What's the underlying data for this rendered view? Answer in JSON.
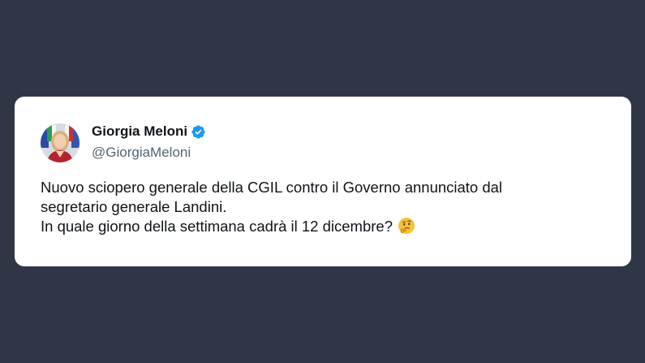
{
  "tweet": {
    "author": {
      "display_name": "Giorgia Meloni",
      "handle": "@GiorgiaMeloni",
      "verified": true
    },
    "text_lines": [
      "Nuovo sciopero generale della CGIL contro il Governo annunciato dal",
      "segretario generale Landini.",
      "In quale giorno della settimana cadrà il 12 dicembre?"
    ],
    "emoji": "thinking-face-icon"
  },
  "colors": {
    "background": "#2f3746",
    "card": "#ffffff",
    "verified_badge": "#1d9bf0",
    "text_primary": "#0f1419",
    "text_secondary": "#536471"
  }
}
